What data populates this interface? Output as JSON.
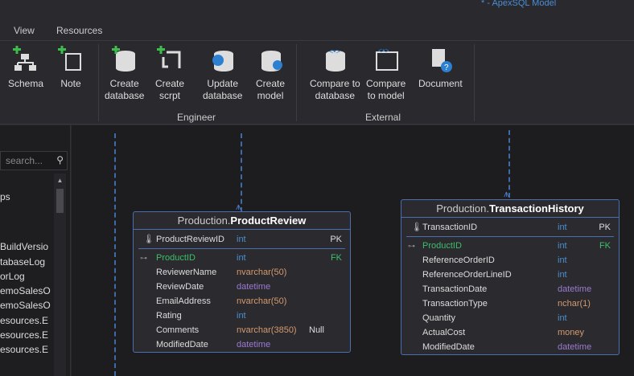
{
  "window": {
    "title": "* - ApexSQL Model"
  },
  "menu": [
    {
      "label": "View"
    },
    {
      "label": "Resources"
    }
  ],
  "ribbon": {
    "buttons": [
      {
        "label1": "Schema",
        "label2": ""
      },
      {
        "label1": "Note",
        "label2": ""
      },
      {
        "label1": "Create",
        "label2": "database"
      },
      {
        "label1": "Create",
        "label2": "scrpt"
      },
      {
        "label1": "Update",
        "label2": "database"
      },
      {
        "label1": "Create",
        "label2": "model"
      },
      {
        "label1": "Compare to",
        "label2": "database"
      },
      {
        "label1": "Compare",
        "label2": "to model"
      },
      {
        "label1": "Document",
        "label2": ""
      }
    ],
    "groups": {
      "engineer": "Engineer",
      "external": "External"
    }
  },
  "sidebar": {
    "search_placeholder": "search...",
    "items": [
      "ps",
      "BuildVersio",
      "tabaseLog",
      "orLog",
      "emoSalesO",
      "emoSalesO",
      "esources.E",
      "esources.E",
      "esources.E"
    ]
  },
  "colors": {
    "accent": "#4a6fb0",
    "fk": "#3cbf6a",
    "int": "#4a8fd0",
    "nvarchar": "#d49a70",
    "datetime": "#9a7bd0"
  },
  "tables": [
    {
      "schema": "Production.",
      "name": "ProductReview",
      "pk": {
        "name": "ProductReviewID",
        "type": "int",
        "key": "PK"
      },
      "columns": [
        {
          "name": "ProductID",
          "type": "int",
          "key": "FK",
          "extra": ""
        },
        {
          "name": "ReviewerName",
          "type": "nvarchar(50)",
          "key": "",
          "extra": ""
        },
        {
          "name": "ReviewDate",
          "type": "datetime",
          "key": "",
          "extra": ""
        },
        {
          "name": "EmailAddress",
          "type": "nvarchar(50)",
          "key": "",
          "extra": ""
        },
        {
          "name": "Rating",
          "type": "int",
          "key": "",
          "extra": ""
        },
        {
          "name": "Comments",
          "type": "nvarchar(3850)",
          "key": "",
          "extra": "Null"
        },
        {
          "name": "ModifiedDate",
          "type": "datetime",
          "key": "",
          "extra": ""
        }
      ]
    },
    {
      "schema": "Production.",
      "name": "TransactionHistory",
      "pk": {
        "name": "TransactionID",
        "type": "int",
        "key": "PK"
      },
      "columns": [
        {
          "name": "ProductID",
          "type": "int",
          "key": "FK",
          "extra": ""
        },
        {
          "name": "ReferenceOrderID",
          "type": "int",
          "key": "",
          "extra": ""
        },
        {
          "name": "ReferenceOrderLineID",
          "type": "int",
          "key": "",
          "extra": ""
        },
        {
          "name": "TransactionDate",
          "type": "datetime",
          "key": "",
          "extra": ""
        },
        {
          "name": "TransactionType",
          "type": "nchar(1)",
          "key": "",
          "extra": ""
        },
        {
          "name": "Quantity",
          "type": "int",
          "key": "",
          "extra": ""
        },
        {
          "name": "ActualCost",
          "type": "money",
          "key": "",
          "extra": ""
        },
        {
          "name": "ModifiedDate",
          "type": "datetime",
          "key": "",
          "extra": ""
        }
      ]
    }
  ]
}
